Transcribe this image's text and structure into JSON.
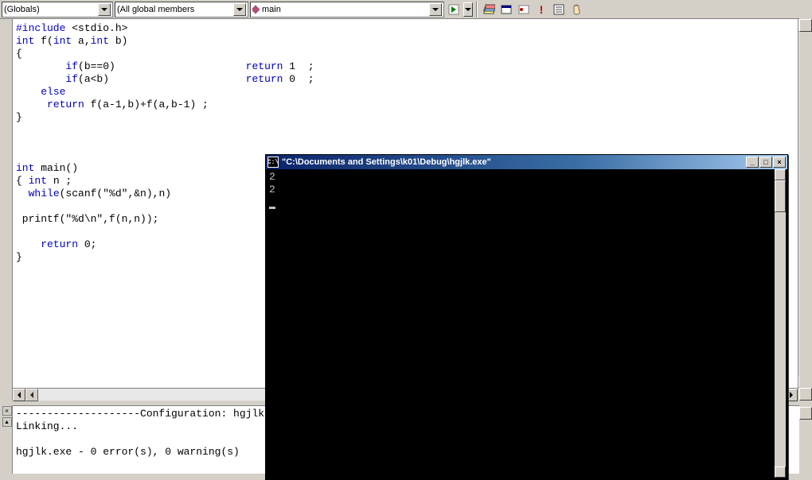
{
  "toolbar": {
    "scope_dropdown": "(Globals)",
    "members_dropdown": "(All global members",
    "function_dropdown": "main"
  },
  "icons": {
    "go": "go-icon",
    "bookmarks": "stack-icon",
    "window": "window-icon",
    "breakpoint": "breakpoint-icon",
    "exclaim": "!",
    "list": "list-icon",
    "hand": "hand-icon"
  },
  "code": {
    "l1a": "#include",
    "l1b": " <stdio.h>",
    "l2a": "int",
    "l2b": " f(",
    "l2c": "int",
    "l2d": " a,",
    "l2e": "int",
    "l2f": " b)",
    "l3": "{",
    "l4a": "        ",
    "l4b": "if",
    "l4c": "(b==0)                     ",
    "l4d": "return",
    "l4e": " 1  ;",
    "l5a": "        ",
    "l5b": "if",
    "l5c": "(a<b)                      ",
    "l5d": "return",
    "l5e": " 0  ;",
    "l6a": "    ",
    "l6b": "else",
    "l7a": "     ",
    "l7b": "return",
    "l7c": " f(a-1,b)+f(a,b-1) ;",
    "l8": "}",
    "blank1": "",
    "blank2": "",
    "blank3": "",
    "m1a": "int",
    "m1b": " main()",
    "m2a": "{ ",
    "m2b": "int",
    "m2c": " n ;",
    "m3a": "  ",
    "m3b": "while",
    "m3c": "(scanf(\"%d\",&n),n)",
    "blank4": "",
    "m4a": " printf(\"%d\\n\",f(n,n));",
    "blank5": "",
    "m5a": "    ",
    "m5b": "return",
    "m5c": " 0;",
    "m6": "}"
  },
  "output": {
    "line1": "--------------------Configuration: hgjlk",
    "line2": "Linking...",
    "line3": "",
    "line4": "hgjlk.exe - 0 error(s), 0 warning(s)"
  },
  "console": {
    "title": "\"C:\\Documents and Settings\\k01\\Debug\\hgjlk.exe\"",
    "icon_text": "C:\\",
    "line1": "2",
    "line2": "2"
  }
}
